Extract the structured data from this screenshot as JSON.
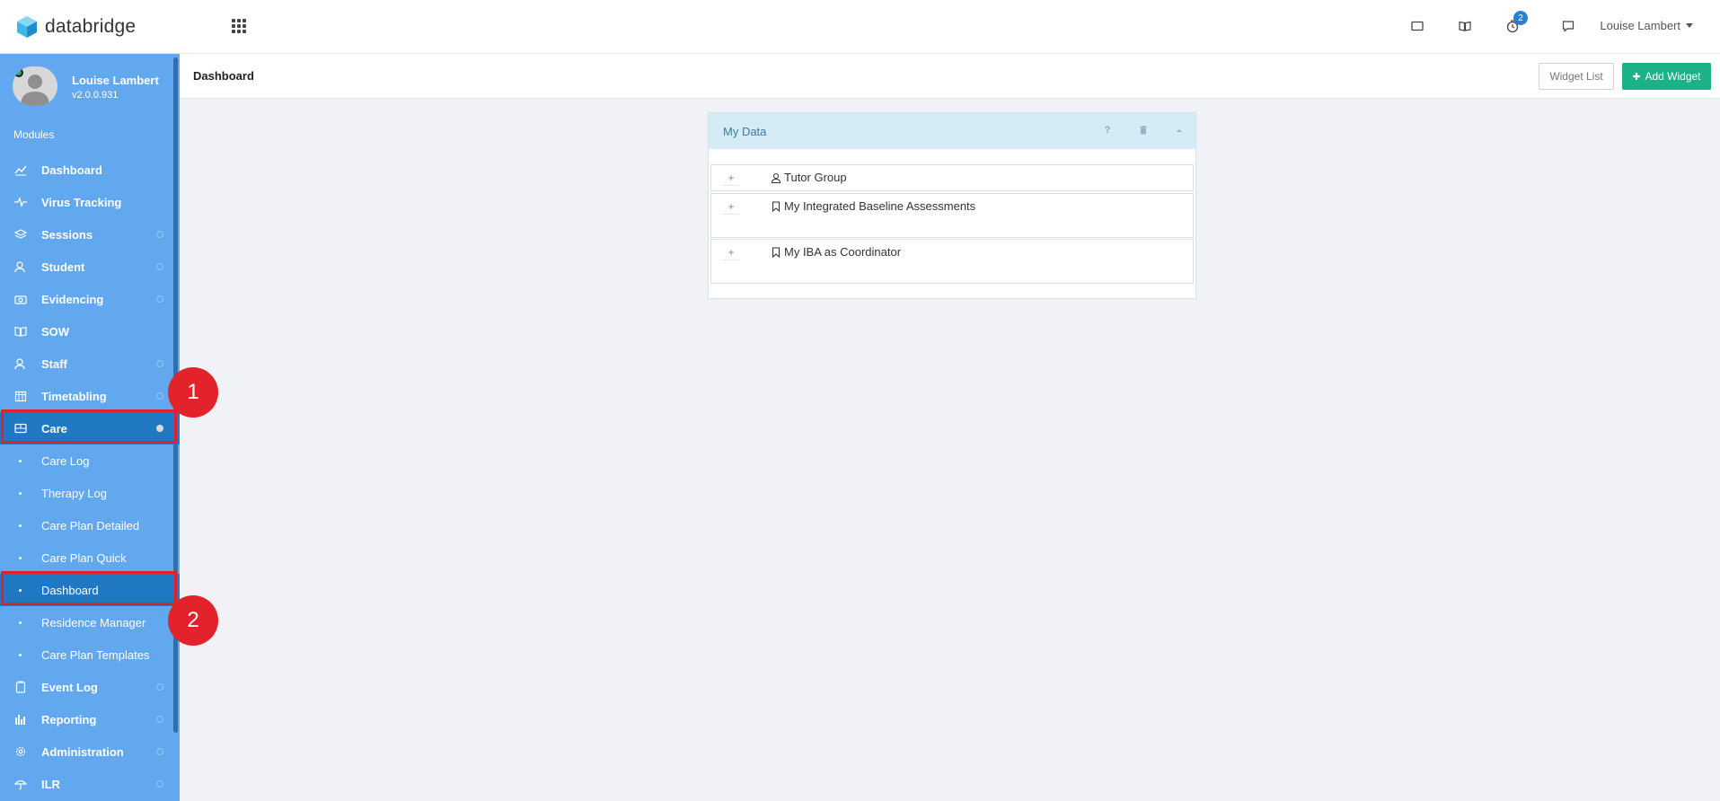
{
  "brand": {
    "name": "databridge"
  },
  "topbar": {
    "notification_count": "2",
    "user_name": "Louise Lambert"
  },
  "sidebar": {
    "profile": {
      "name": "Louise Lambert",
      "version": "v2.0.0.931"
    },
    "modules_label": "Modules",
    "items": [
      {
        "label": "Dashboard",
        "icon": "chart-line-icon"
      },
      {
        "label": "Virus Tracking",
        "icon": "pulse-icon"
      },
      {
        "label": "Sessions",
        "icon": "layers-icon"
      },
      {
        "label": "Student",
        "icon": "users-icon"
      },
      {
        "label": "Evidencing",
        "icon": "camera-icon"
      },
      {
        "label": "SOW",
        "icon": "book-icon"
      },
      {
        "label": "Staff",
        "icon": "users-icon"
      },
      {
        "label": "Timetabling",
        "icon": "calendar-icon"
      },
      {
        "label": "Care",
        "icon": "id-card-icon"
      }
    ],
    "care_subitems": [
      {
        "label": "Care Log"
      },
      {
        "label": "Therapy Log"
      },
      {
        "label": "Care Plan Detailed"
      },
      {
        "label": "Care Plan Quick"
      },
      {
        "label": "Dashboard"
      },
      {
        "label": "Residence Manager"
      },
      {
        "label": "Care Plan Templates"
      }
    ],
    "bottom_items": [
      {
        "label": "Event Log",
        "icon": "clipboard-icon"
      },
      {
        "label": "Reporting",
        "icon": "bar-chart-icon"
      },
      {
        "label": "Administration",
        "icon": "gear-icon"
      },
      {
        "label": "ILR",
        "icon": "umbrella-icon"
      }
    ]
  },
  "callouts": {
    "first": "1",
    "second": "2"
  },
  "page": {
    "title": "Dashboard",
    "widget_list_label": "Widget List",
    "add_widget_label": "Add Widget"
  },
  "widget": {
    "title": "My Data",
    "help_label": "?",
    "rows": [
      {
        "label": "Tutor Group",
        "icon": "user-icon"
      },
      {
        "label": "My Integrated Baseline Assessments",
        "icon": "bookmark-icon"
      },
      {
        "label": "My IBA as Coordinator",
        "icon": "bookmark-icon"
      }
    ],
    "expand_symbol": "+"
  },
  "colors": {
    "sidebar_bg": "#62a8ee",
    "sidebar_active": "#1f78c1",
    "accent_green": "#1bb288",
    "highlight_red": "#e0202a",
    "widget_header": "#d5ebf6"
  }
}
